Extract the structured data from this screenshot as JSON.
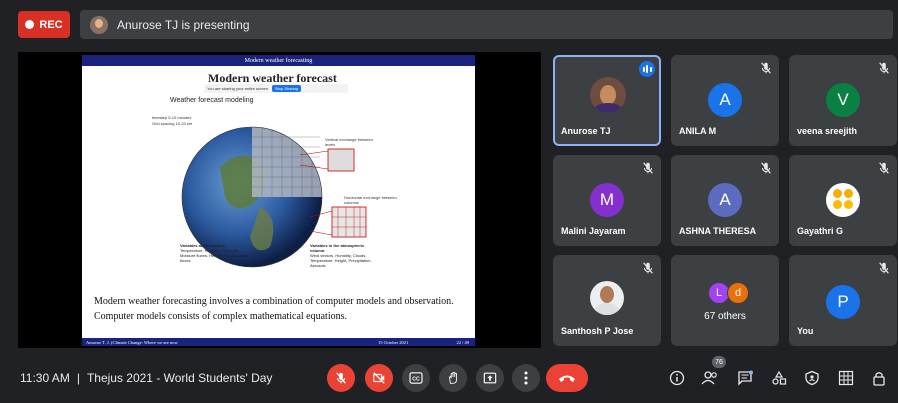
{
  "top_bar": {
    "rec_label": "REC",
    "presenting_text": "Anurose TJ is presenting"
  },
  "slide": {
    "header": "Modern weather forecasting",
    "title": "Modern weather forecast",
    "share_banner_text": "You are sharing your entire screen",
    "share_banner_stop": "Stop Sharing",
    "subtitle": "Weather forecast modeling",
    "diagram_labels": {
      "timestep": "timestep 5-10 minutes",
      "grid": "Grid spacing 10-20 km",
      "vertical": "Vertical exchange between levels",
      "horizontal": "Horizontal exchange between columns",
      "surface_title": "Variables at the surface:",
      "surface_items": "Temperature, Humidity, Pressure, Moisture fluxes, Heat fluxes, Radiation fluxes",
      "column_title": "Variables in the atmospheric column:",
      "column_items": "Wind vectors, Humidity, Clouds, Temperature, Height, Precipitation, Aerosols"
    },
    "text_1": "Modern weather forecasting involves a combination of computer models and observation.",
    "text_2": "Computer models consists of complex mathematical equations.",
    "footer_left": "Anurose T. J. (Climate Change: Where we are now",
    "footer_date": "15 October 2021",
    "footer_page": "22 / 49"
  },
  "participants": [
    {
      "name": "Anurose TJ",
      "type": "photo",
      "speaking": true
    },
    {
      "name": "ANILA M",
      "initial": "A",
      "color": "#1a73e8",
      "muted": true
    },
    {
      "name": "veena sreejith",
      "initial": "V",
      "color": "#0b8043",
      "muted": true
    },
    {
      "name": "Malini Jayaram",
      "initial": "M",
      "color": "#8430ce",
      "muted": true
    },
    {
      "name": "ASHNA THERESA",
      "initial": "A",
      "color": "#5c6bc0",
      "muted": true
    },
    {
      "name": "Gayathri G",
      "type": "emoji",
      "muted": true
    },
    {
      "name": "Santhosh P Jose",
      "type": "photo",
      "muted": true
    },
    {
      "name": "67 others",
      "type": "others",
      "avatars": [
        {
          "initial": "L",
          "color": "#a142f4"
        },
        {
          "initial": "d",
          "color": "#e8710a"
        }
      ]
    },
    {
      "name": "You",
      "initial": "P",
      "color": "#1a73e8",
      "muted": true
    }
  ],
  "bottom_bar": {
    "time": "11:30 AM",
    "separator": "|",
    "meeting_title": "Thejus 2021 - World Students' Day",
    "people_count": "76",
    "icons": [
      "mic-off-icon",
      "camera-off-icon",
      "captions-icon",
      "raise-hand-icon",
      "present-icon",
      "more-options-icon",
      "end-call-icon",
      "info-icon",
      "people-icon",
      "chat-icon",
      "activities-icon",
      "host-controls-icon",
      "grid-icon",
      "lock-icon"
    ],
    "colors": {
      "danger": "#ea4335",
      "surface": "#3c4043",
      "accent": "#1a73e8"
    }
  }
}
